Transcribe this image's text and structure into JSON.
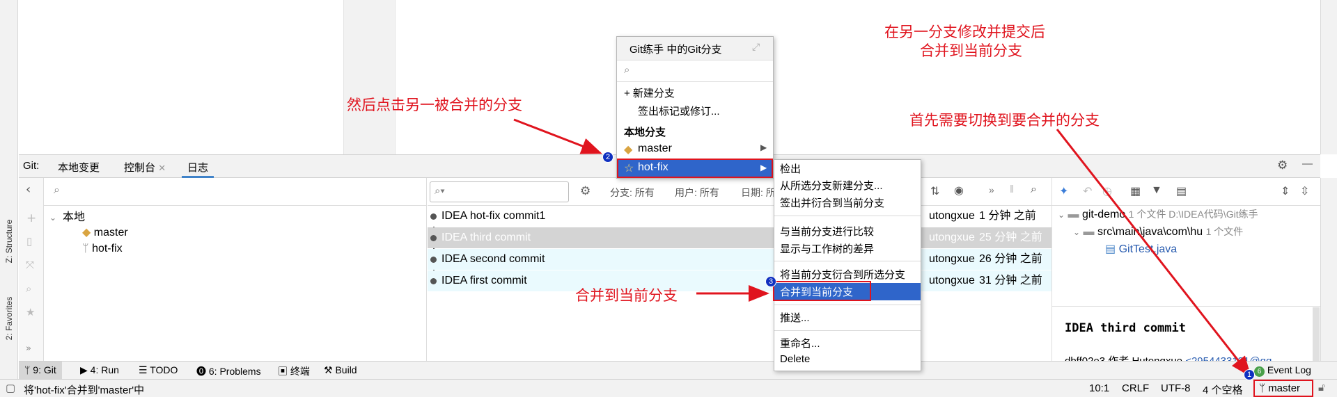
{
  "popup": {
    "title": "Git练手 中的Git分支",
    "new_branch": "+ 新建分支",
    "checkout_tag": "签出标记或修订...",
    "local_header": "本地分支",
    "branches": [
      "master",
      "hot-fix"
    ]
  },
  "submenu": {
    "items": [
      "检出",
      "从所选分支新建分支...",
      "签出并衍合到当前分支",
      "与当前分支进行比较",
      "显示与工作树的差异",
      "将当前分支衍合到所选分支",
      "合并到当前分支",
      "推送...",
      "重命名...",
      "Delete"
    ]
  },
  "annotations": {
    "top_right_1": "在另一分支修改并提交后",
    "top_right_2": "合并到当前分支",
    "click_other": "然后点击另一被合并的分支",
    "switch_first": "首先需要切换到要合并的分支",
    "merge_label": "合并到当前分支"
  },
  "badges": [
    "1",
    "2",
    "3"
  ],
  "toolwindow": {
    "prefix": "Git:",
    "tabs": [
      "本地变更",
      "控制台",
      "日志"
    ]
  },
  "log": {
    "filter": {
      "branch": "分支: 所有",
      "user": "用户: 所有",
      "date": "日期: 所"
    },
    "tree": {
      "root": "本地",
      "items": [
        "master",
        "hot-fix"
      ]
    },
    "commits": [
      {
        "msg": "IDEA hot-fix commit1",
        "author": "utongxue",
        "time": "1 分钟 之前"
      },
      {
        "msg": "IDEA third commit",
        "author": "utongxue",
        "time": "25 分钟 之前"
      },
      {
        "msg": "IDEA second commit",
        "author": "utongxue",
        "time": "26 分钟 之前"
      },
      {
        "msg": "IDEA first commit",
        "author": "utongxue",
        "time": "31 分钟 之前"
      }
    ]
  },
  "details": {
    "repo": "git-demo",
    "repo_info": "1 个文件  D:\\IDEA代码\\Git练手",
    "path": "src\\main\\java\\com\\hu",
    "path_info": "1 个文件",
    "file": "GitTest.java",
    "commit_title": "IDEA third commit",
    "commit_hash": "dbff02e3 作者 Hutongxue",
    "commit_email": "<2954433131@qq"
  },
  "side": {
    "structure": "Z: Structure",
    "favorites": "2: Favorites"
  },
  "bottom_tabs": [
    "9: Git",
    "4: Run",
    "TODO",
    "6: Problems",
    "终端",
    "Build"
  ],
  "event_log": {
    "count": "6",
    "label": "Event Log"
  },
  "status": {
    "message": "将'hot-fix'合并到'master'中",
    "position": "10:1",
    "line_sep": "CRLF",
    "encoding": "UTF-8",
    "indent": "4 个空格",
    "branch": "master"
  }
}
